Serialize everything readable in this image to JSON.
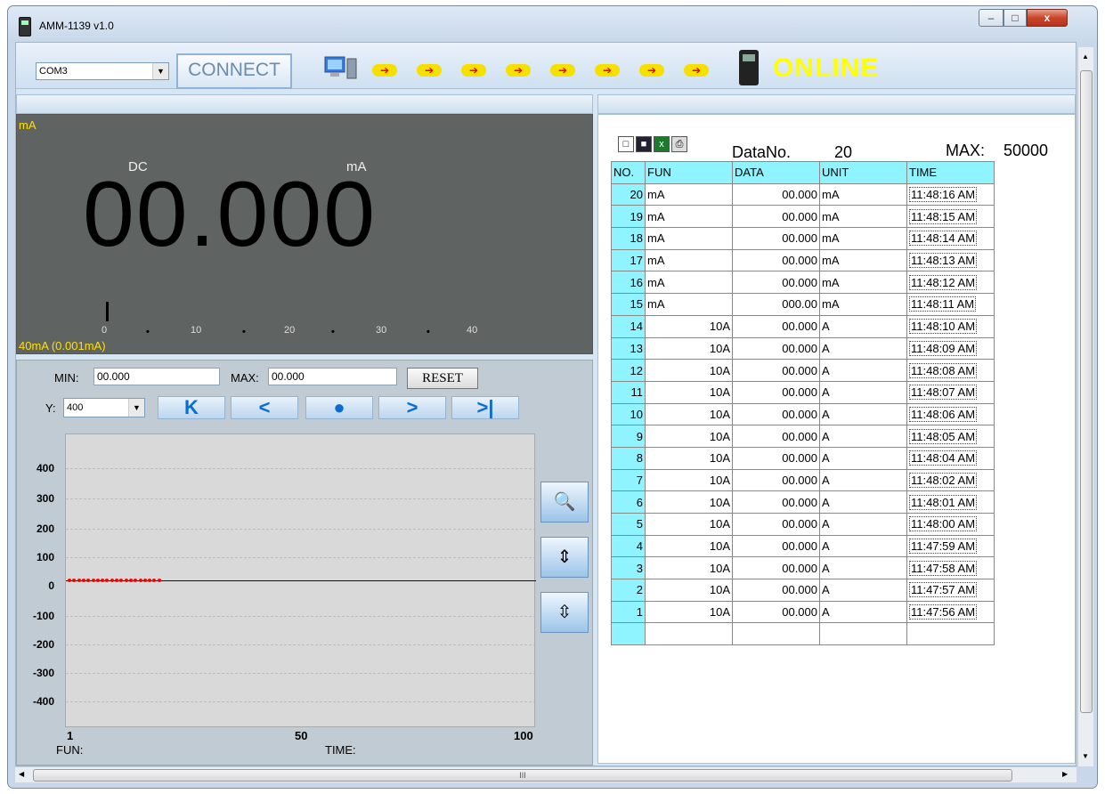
{
  "window": {
    "title": "AMM-1139  v1.0",
    "min": "–",
    "max": "□",
    "close": "x"
  },
  "toolbar": {
    "com_port": "COM3",
    "connect_label": "CONNECT",
    "status": "ONLINE",
    "status_color": "#ffff00"
  },
  "display": {
    "unit_top": "mA",
    "mode": "DC",
    "unit": "mA",
    "reading": "00.000",
    "range": "40mA  (0.001mA)",
    "scale": [
      "0",
      "10",
      "20",
      "30",
      "40"
    ]
  },
  "stats": {
    "min_label": "MIN:",
    "min_value": "00.000",
    "max_label": "MAX:",
    "max_value": "00.000",
    "reset_label": "RESET",
    "y_label": "Y:",
    "y_value": "400"
  },
  "nav": {
    "first": "K",
    "prev": "<",
    "record": "●",
    "next": ">",
    "last": ">|"
  },
  "graph": {
    "y_ticks": [
      "400",
      "300",
      "200",
      "100",
      "0",
      "-100",
      "-200",
      "-300",
      "-400"
    ],
    "x_ticks": [
      "1",
      "50",
      "100"
    ],
    "fun_label": "FUN:",
    "time_label": "TIME:"
  },
  "log": {
    "datano_label": "DataNo.",
    "datano_value": "20",
    "max_label": "MAX:",
    "max_value": "50000",
    "headers": [
      "NO.",
      "FUN",
      "DATA",
      "UNIT",
      "TIME"
    ],
    "rows": [
      [
        "20",
        "mA",
        "00.000",
        "mA",
        "11:48:16 AM"
      ],
      [
        "19",
        "mA",
        "00.000",
        "mA",
        "11:48:15 AM"
      ],
      [
        "18",
        "mA",
        "00.000",
        "mA",
        "11:48:14 AM"
      ],
      [
        "17",
        "mA",
        "00.000",
        "mA",
        "11:48:13 AM"
      ],
      [
        "16",
        "mA",
        "00.000",
        "mA",
        "11:48:12 AM"
      ],
      [
        "15",
        "mA",
        "000.00",
        "mA",
        "11:48:11 AM"
      ],
      [
        "14",
        "10A",
        "00.000",
        "A",
        "11:48:10 AM"
      ],
      [
        "13",
        "10A",
        "00.000",
        "A",
        "11:48:09 AM"
      ],
      [
        "12",
        "10A",
        "00.000",
        "A",
        "11:48:08 AM"
      ],
      [
        "11",
        "10A",
        "00.000",
        "A",
        "11:48:07 AM"
      ],
      [
        "10",
        "10A",
        "00.000",
        "A",
        "11:48:06 AM"
      ],
      [
        "9",
        "10A",
        "00.000",
        "A",
        "11:48:05 AM"
      ],
      [
        "8",
        "10A",
        "00.000",
        "A",
        "11:48:04 AM"
      ],
      [
        "7",
        "10A",
        "00.000",
        "A",
        "11:48:02 AM"
      ],
      [
        "6",
        "10A",
        "00.000",
        "A",
        "11:48:01 AM"
      ],
      [
        "5",
        "10A",
        "00.000",
        "A",
        "11:48:00 AM"
      ],
      [
        "4",
        "10A",
        "00.000",
        "A",
        "11:47:59 AM"
      ],
      [
        "3",
        "10A",
        "00.000",
        "A",
        "11:47:58 AM"
      ],
      [
        "2",
        "10A",
        "00.000",
        "A",
        "11:47:57 AM"
      ],
      [
        "1",
        "10A",
        "00.000",
        "A",
        "11:47:56 AM"
      ]
    ]
  },
  "scroll": {
    "grip": "III"
  }
}
